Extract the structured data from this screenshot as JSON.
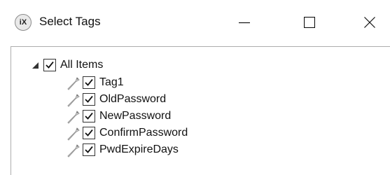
{
  "window": {
    "title": "Select Tags",
    "app_icon_text": "iX"
  },
  "tree": {
    "root": {
      "label": "All Items",
      "checked": true,
      "expanded": true
    },
    "items": [
      {
        "label": "Tag1",
        "checked": true,
        "icon": "tag-icon"
      },
      {
        "label": "OldPassword",
        "checked": true,
        "icon": "tag-icon"
      },
      {
        "label": "NewPassword",
        "checked": true,
        "icon": "tag-icon"
      },
      {
        "label": "ConfirmPassword",
        "checked": true,
        "icon": "tag-icon"
      },
      {
        "label": "PwdExpireDays",
        "checked": true,
        "icon": "tag-icon"
      }
    ]
  }
}
